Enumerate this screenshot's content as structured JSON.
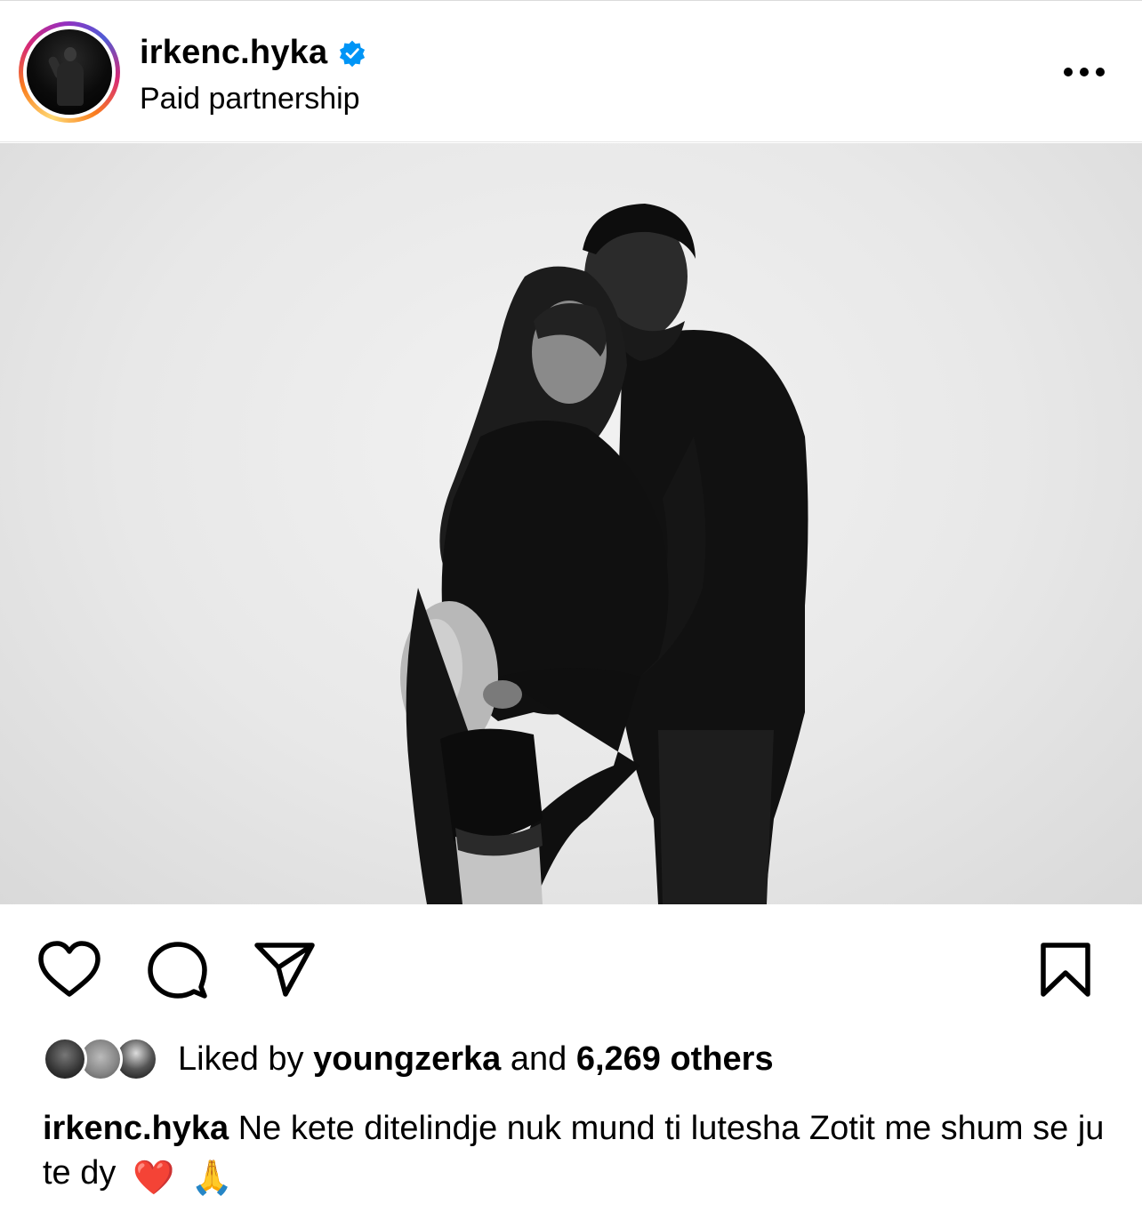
{
  "post": {
    "username": "irkenc.hyka",
    "subtitle": "Paid partnership",
    "verified": true
  },
  "actions": {
    "like_icon": "heart-icon",
    "comment_icon": "comment-icon",
    "share_icon": "share-icon",
    "save_icon": "bookmark-icon"
  },
  "likes": {
    "prefix": "Liked by",
    "user": "youngzerka",
    "middle": "and",
    "others": "6,269 others"
  },
  "caption": {
    "username": "irkenc.hyka",
    "text": "Ne kete ditelindje nuk mund ti lutesha Zotit me shum se ju te dy",
    "emojis": [
      "❤️",
      "🙏"
    ]
  },
  "colors": {
    "verified_blue": "#0095f6",
    "text": "#000000",
    "divider": "#dbdbdb"
  }
}
